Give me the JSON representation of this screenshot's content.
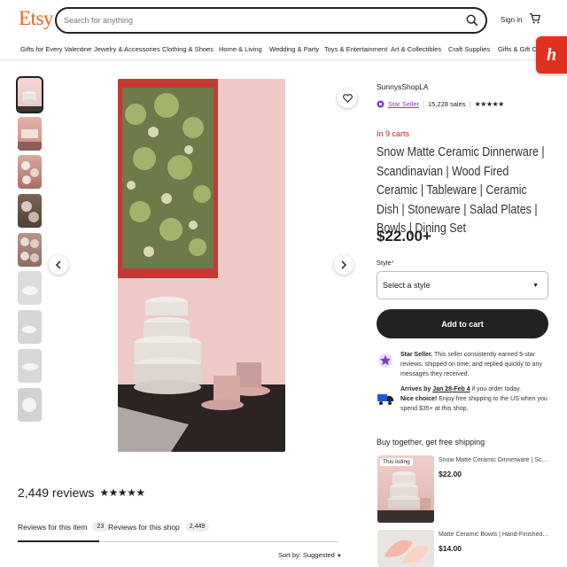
{
  "header": {
    "logo": "Etsy",
    "search_placeholder": "Search for anything",
    "signin": "Sign in"
  },
  "categories": [
    "Gifts for Every Valentine",
    "Jewelry & Accessories",
    "Clothing & Shoes",
    "Home & Living",
    "Wedding & Party",
    "Toys & Entertainment",
    "Art & Collectibles",
    "Craft Supplies",
    "Gifts & Gift Cards"
  ],
  "honey": "h",
  "listing": {
    "shop_name": "SunnysShopLA",
    "star_seller": "Star Seller",
    "sales": "15,228 sales",
    "stars": "★★★★★",
    "in_carts": "In 9 carts",
    "title": "Snow Matte Ceramic Dinnerware | Scandinavian | Wood Fired Ceramic | Tableware | Ceramic Dish | Stoneware | Salad Plates | Bowls | Dining Set",
    "price": "$22.00+",
    "style_label": "Style",
    "style_required": "*",
    "style_placeholder": "Select a style",
    "add_to_cart": "Add to cart"
  },
  "info": {
    "star_seller_bold": "Star Seller.",
    "star_seller_text": " This seller consistently earned 5-star reviews, shipped on time, and replied quickly to any messages they received.",
    "arrives_prefix": "Arrives by ",
    "arrives_dates": "Jan 28-Feb 4",
    "arrives_suffix": " if you order today.",
    "nice_choice_bold": "Nice choice!",
    "nice_choice_text": " Enjoy free shipping to the US when you spend $35+ at this shop."
  },
  "bundle": {
    "title": "Buy together, get free shipping",
    "items": [
      {
        "badge": "This listing",
        "name": "Snow Matte Ceramic Dinnerware | Scandinavian",
        "price": "$22.00"
      },
      {
        "badge": "",
        "name": "Matte Ceramic Bowls | Hand-Finished Ceramic",
        "price": "$14.00"
      }
    ]
  },
  "reviews": {
    "count": "2,449 reviews",
    "stars": "★★★★★",
    "tab_item": "Reviews for this item",
    "tab_item_count": "23",
    "tab_shop": "Reviews for this shop",
    "tab_shop_count": "2,449",
    "sort": "Sort by: Suggested"
  },
  "colors": {
    "brand": "#F1641E",
    "accent_purple": "#7b3fbf",
    "in_carts": "#b3270e",
    "button_dark": "#222222"
  }
}
